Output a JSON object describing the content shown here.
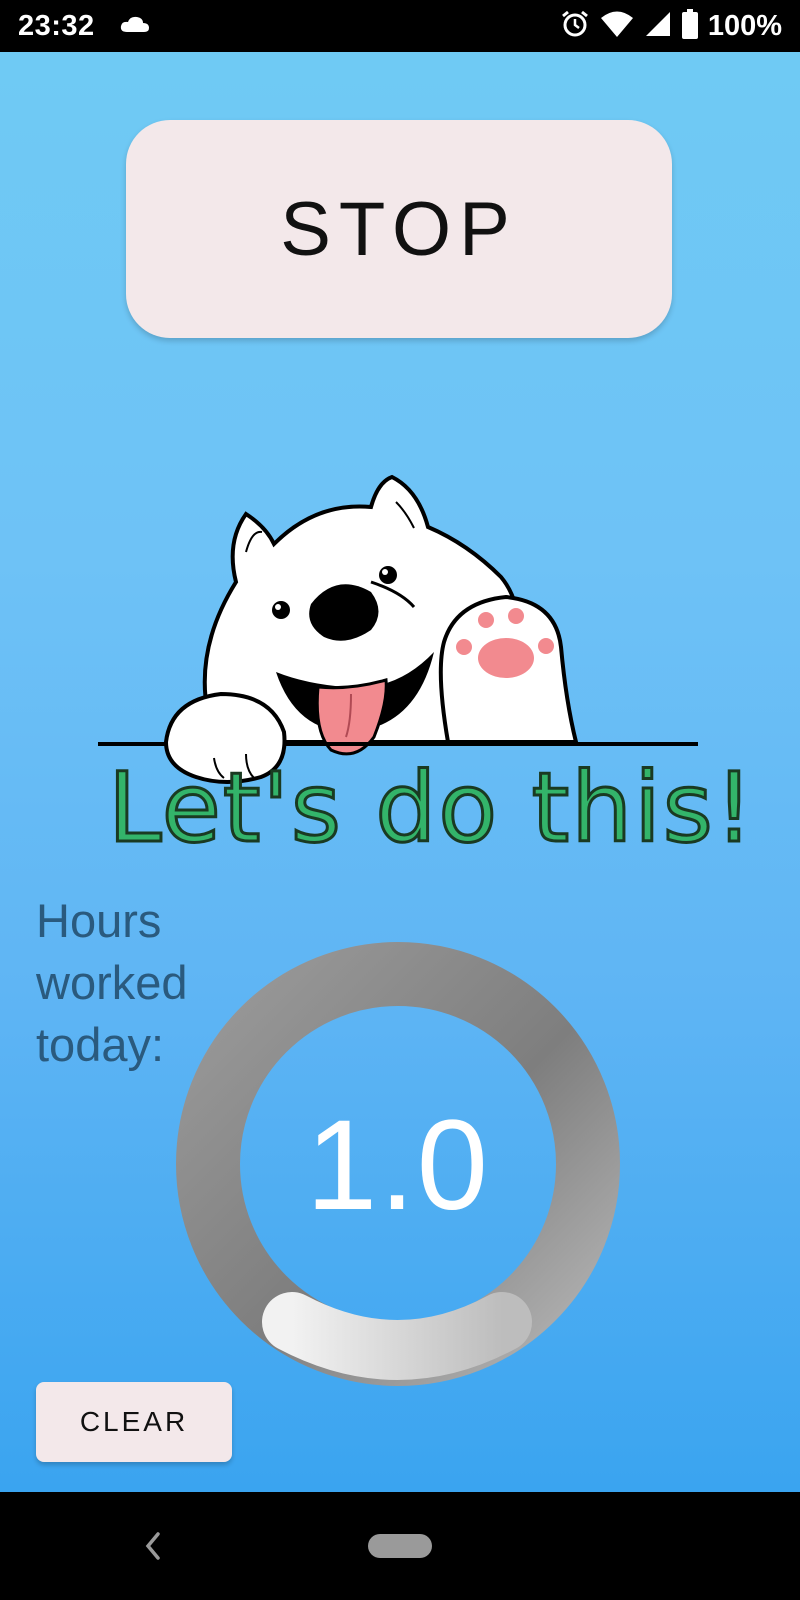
{
  "status_bar": {
    "time": "23:32",
    "battery_percent": "100%",
    "icons": [
      "cloud-icon",
      "alarm-icon",
      "wifi-icon",
      "signal-icon",
      "battery-icon"
    ]
  },
  "main": {
    "stop_label": "STOP",
    "headline": "Let's do this!",
    "hours_label": "Hours worked today:",
    "hours_value": "1.0",
    "clear_label": "CLEAR"
  },
  "nav_bar": {
    "icons": [
      "back-icon",
      "home-pill-icon"
    ]
  },
  "colors": {
    "background_top": "#6fcaf4",
    "background_bottom": "#3aa4f0",
    "button_bg": "#f3e8ea",
    "headline_green": "#33b46a",
    "label_text": "#2a5a7e",
    "ring_gray": "#8a8a8a",
    "ring_light": "#e6e6e6"
  }
}
